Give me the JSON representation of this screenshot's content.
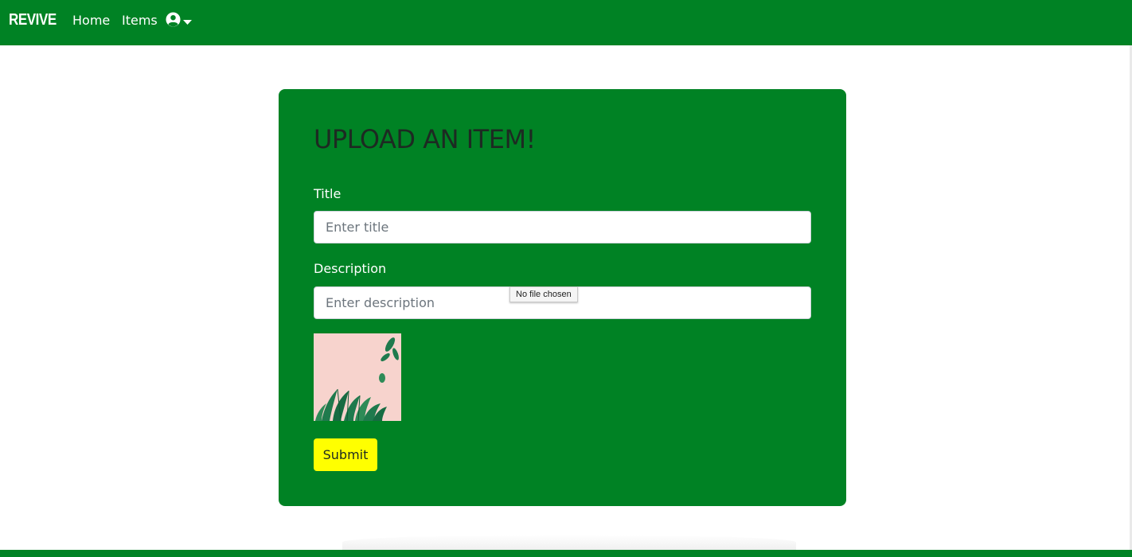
{
  "nav": {
    "brand": "REVIVE",
    "links": [
      {
        "label": "Home"
      },
      {
        "label": "Items"
      }
    ],
    "user_icon": "user-circle-icon",
    "caret_icon": "caret-down-icon"
  },
  "form": {
    "heading": "UPLOAD AN ITEM!",
    "title_label": "Title",
    "title_placeholder": "Enter title",
    "title_value": "",
    "description_label": "Description",
    "description_placeholder": "Enter description",
    "description_value": "",
    "file_tooltip": "No file chosen",
    "image_icon": "plant-leaves-image",
    "submit_label": "Submit"
  },
  "colors": {
    "primary_green": "#008224",
    "submit_yellow": "#ffff00",
    "heading_text": "#1d2a22",
    "thumbnail_pink": "#f7d3cd",
    "leaf_green": "#1f7a4d"
  }
}
